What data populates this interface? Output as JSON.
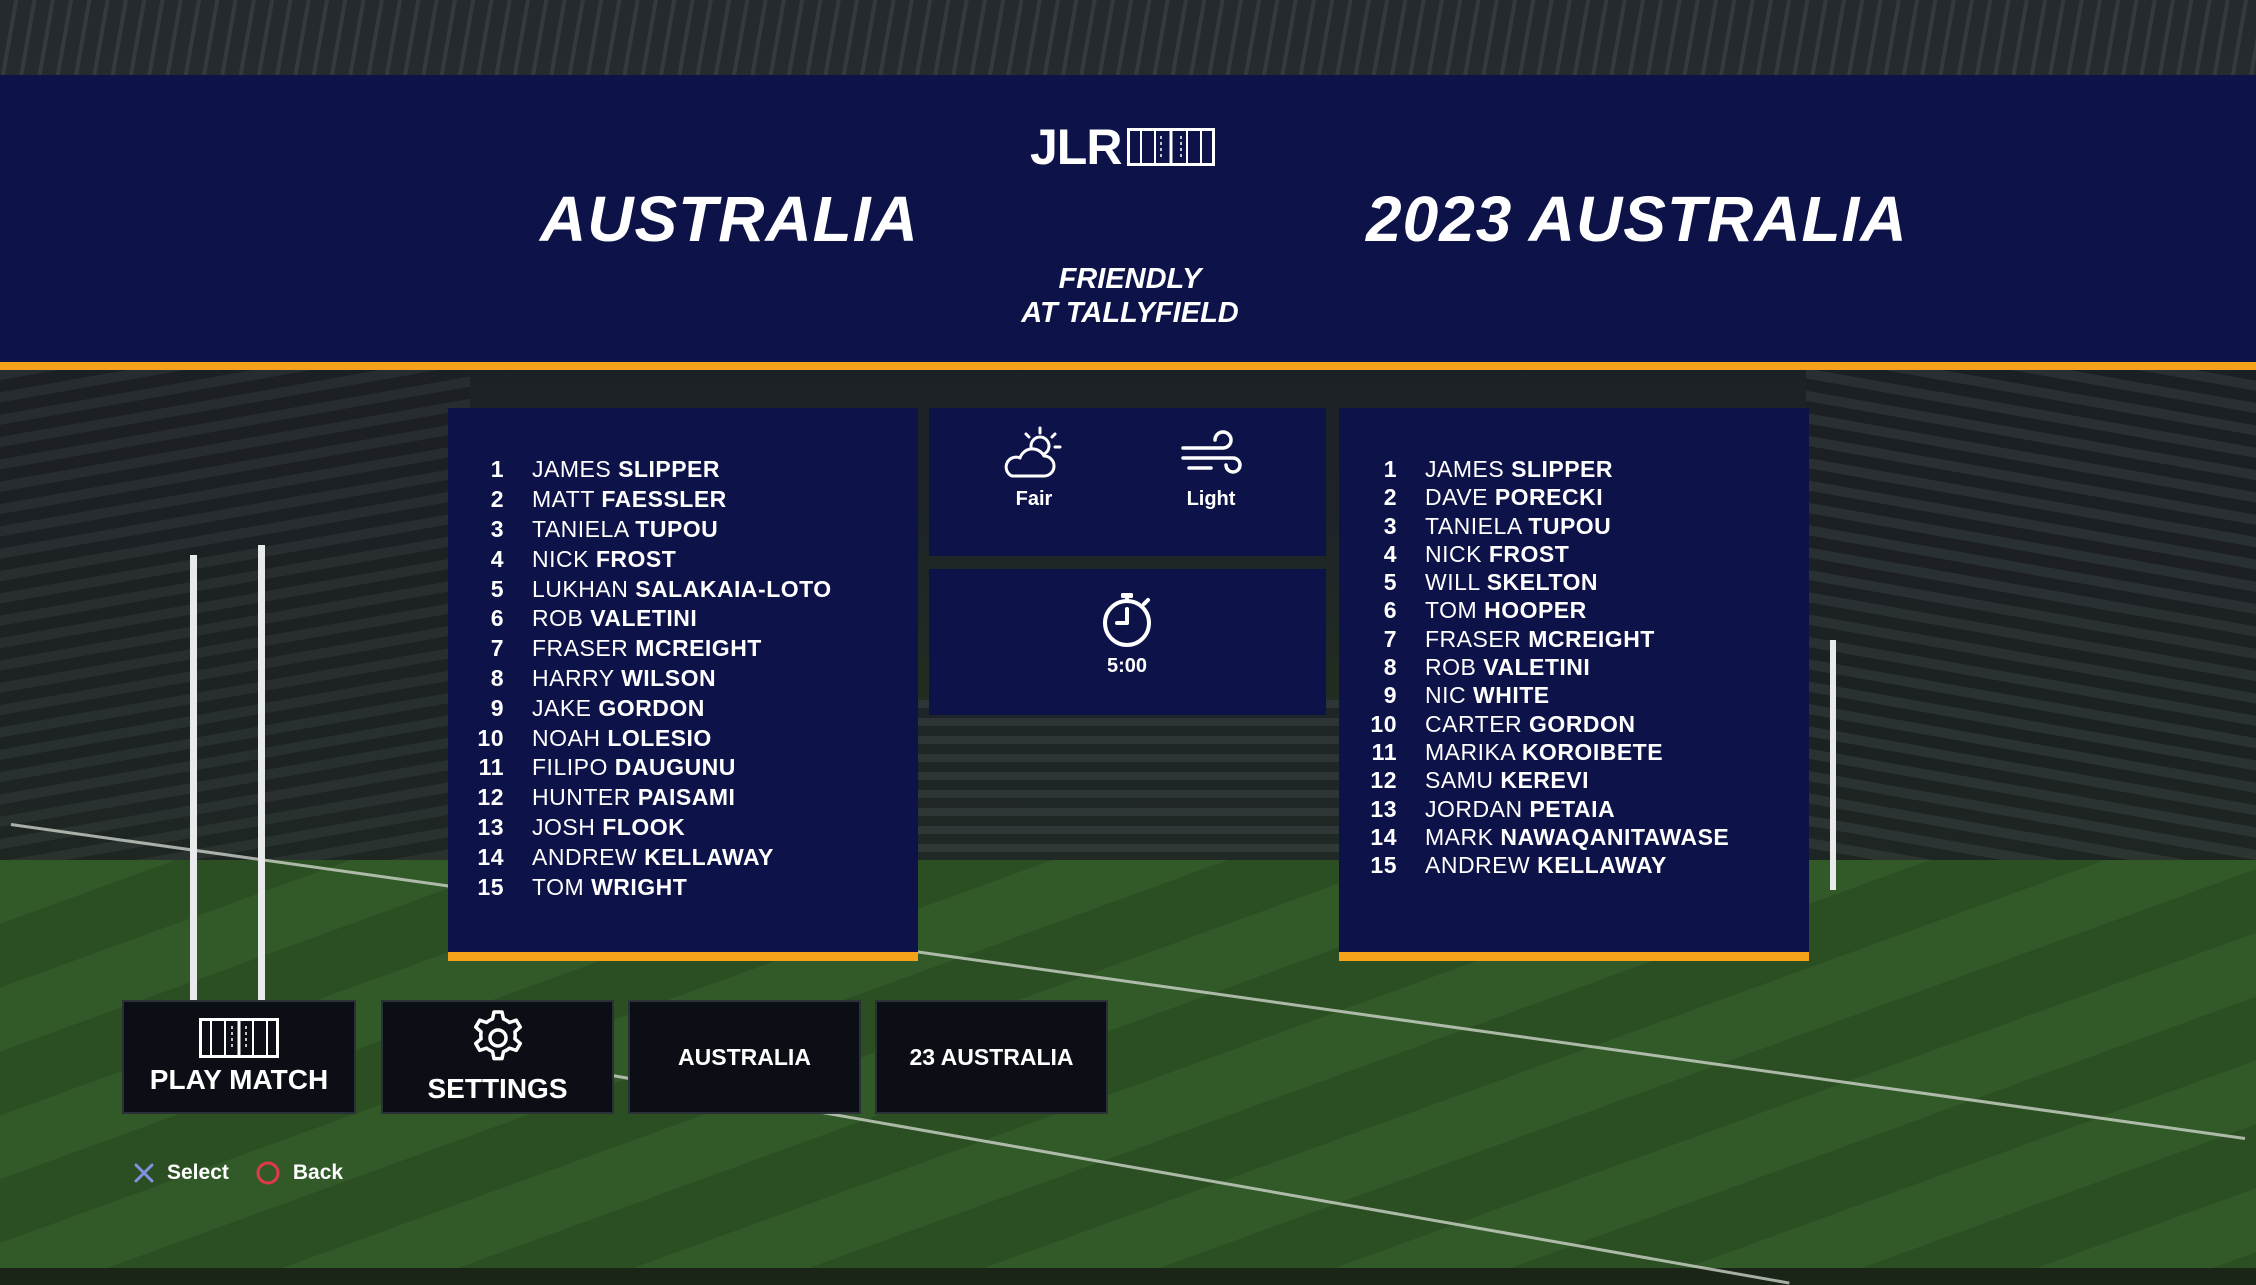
{
  "header": {
    "logo_text": "JLR",
    "home_team": "AUSTRALIA",
    "away_team": "2023 AUSTRALIA",
    "fixture_line1": "FRIENDLY",
    "fixture_line2": "AT TALLYFIELD"
  },
  "home_lineup": [
    {
      "num": "1",
      "first": "JAMES",
      "last": "SLIPPER"
    },
    {
      "num": "2",
      "first": "MATT",
      "last": "FAESSLER"
    },
    {
      "num": "3",
      "first": "TANIELA",
      "last": "TUPOU"
    },
    {
      "num": "4",
      "first": "NICK",
      "last": "FROST"
    },
    {
      "num": "5",
      "first": "LUKHAN",
      "last": "SALAKAIA-LOTO"
    },
    {
      "num": "6",
      "first": "ROB",
      "last": "VALETINI"
    },
    {
      "num": "7",
      "first": "FRASER",
      "last": "MCREIGHT"
    },
    {
      "num": "8",
      "first": "HARRY",
      "last": "WILSON"
    },
    {
      "num": "9",
      "first": "JAKE",
      "last": "GORDON"
    },
    {
      "num": "10",
      "first": "NOAH",
      "last": "LOLESIO"
    },
    {
      "num": "11",
      "first": "FILIPO",
      "last": "DAUGUNU"
    },
    {
      "num": "12",
      "first": "HUNTER",
      "last": "PAISAMI"
    },
    {
      "num": "13",
      "first": "JOSH",
      "last": "FLOOK"
    },
    {
      "num": "14",
      "first": "ANDREW",
      "last": "KELLAWAY"
    },
    {
      "num": "15",
      "first": "TOM",
      "last": "WRIGHT"
    }
  ],
  "away_lineup": [
    {
      "num": "1",
      "first": "JAMES",
      "last": "SLIPPER"
    },
    {
      "num": "2",
      "first": "DAVE",
      "last": "PORECKI"
    },
    {
      "num": "3",
      "first": "TANIELA",
      "last": "TUPOU"
    },
    {
      "num": "4",
      "first": "NICK",
      "last": "FROST"
    },
    {
      "num": "5",
      "first": "WILL",
      "last": "SKELTON"
    },
    {
      "num": "6",
      "first": "TOM",
      "last": "HOOPER"
    },
    {
      "num": "7",
      "first": "FRASER",
      "last": "MCREIGHT"
    },
    {
      "num": "8",
      "first": "ROB",
      "last": "VALETINI"
    },
    {
      "num": "9",
      "first": "NIC",
      "last": "WHITE"
    },
    {
      "num": "10",
      "first": "CARTER",
      "last": "GORDON"
    },
    {
      "num": "11",
      "first": "MARIKA",
      "last": "KOROIBETE"
    },
    {
      "num": "12",
      "first": "SAMU",
      "last": "KEREVI"
    },
    {
      "num": "13",
      "first": "JORDAN",
      "last": "PETAIA"
    },
    {
      "num": "14",
      "first": "MARK",
      "last": "NAWAQANITAWASE"
    },
    {
      "num": "15",
      "first": "ANDREW",
      "last": "KELLAWAY"
    }
  ],
  "conditions": {
    "weather_icon": "partly-sunny-icon",
    "weather_label": "Fair",
    "wind_icon": "wind-icon",
    "wind_label": "Light",
    "timer_icon": "stopwatch-icon",
    "half_length": "5:00"
  },
  "menu": {
    "play_match": "PLAY MATCH",
    "settings": "SETTINGS",
    "home_team_button": "AUSTRALIA",
    "away_team_button": "23 AUSTRALIA"
  },
  "hints": {
    "select_icon": "cross-button-icon",
    "select_label": "Select",
    "back_icon": "circle-button-icon",
    "back_label": "Back"
  },
  "colors": {
    "panel_navy": "#0d1349",
    "accent_orange": "#f5a21b",
    "button_dark": "#0b0f15",
    "cross_button": "#7f93e0",
    "circle_button": "#e0394a"
  }
}
